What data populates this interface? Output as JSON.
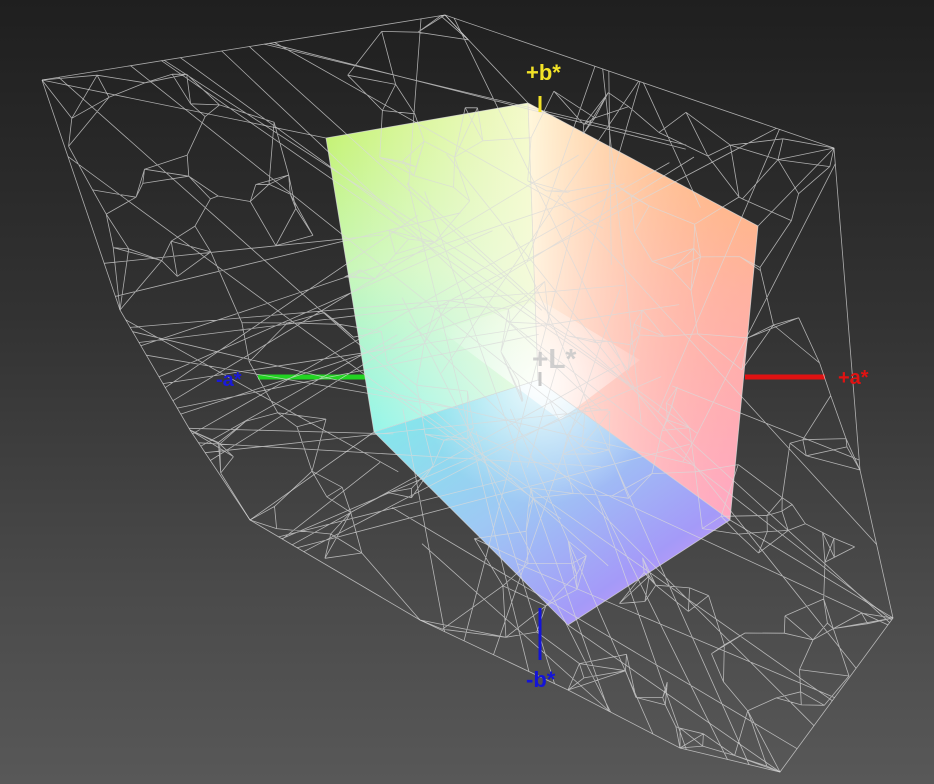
{
  "axes": {
    "plus_b": {
      "label": "+b*",
      "color": "#f2e227"
    },
    "minus_b": {
      "label": "-b*",
      "color": "#1414d8"
    },
    "plus_a": {
      "label": "+a*",
      "color": "#e01212"
    },
    "minus_a": {
      "label": "-a*",
      "color": "#1a1ad8"
    },
    "plus_L": {
      "label": "+L*",
      "color": "#c8c8c8"
    }
  },
  "colors": {
    "minus_a_line": "#22d422",
    "wireframe": "#d9d9d9",
    "background_top": "#1f1f1f",
    "background_bottom": "#585858"
  }
}
